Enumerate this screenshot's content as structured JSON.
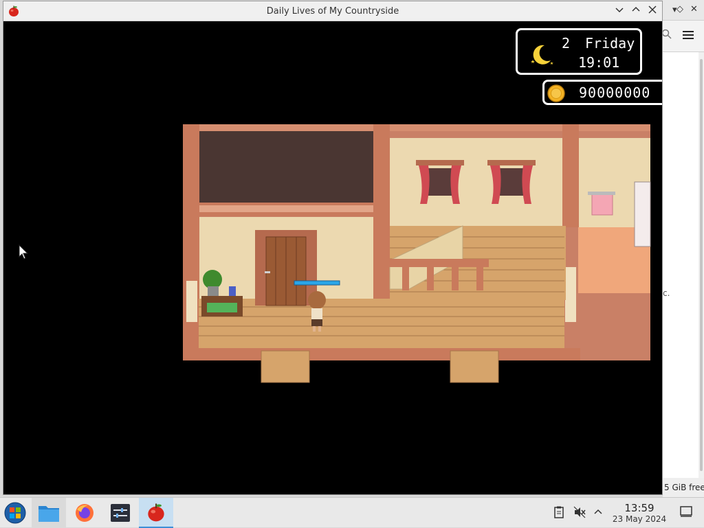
{
  "window": {
    "title": "Daily Lives of My Countryside",
    "controls": [
      "minimize",
      "maximize",
      "close"
    ]
  },
  "hud": {
    "day_number": "2",
    "weekday": "Friday",
    "time": "19:01",
    "money": "90000000",
    "time_of_day_icon": "moon-icon",
    "currency_icon": "coin-icon"
  },
  "background_app": {
    "status_text": "5 GiB free",
    "fragment_text": "c."
  },
  "taskbar": {
    "start_icon": "start-menu-icon",
    "apps": [
      {
        "name": "file-manager",
        "icon": "folder-icon"
      },
      {
        "name": "firefox",
        "icon": "firefox-icon"
      },
      {
        "name": "system-settings",
        "icon": "sliders-icon"
      },
      {
        "name": "game",
        "icon": "apple-icon",
        "active": true
      }
    ],
    "clock_time": "13:59",
    "clock_date": "23 May 2024"
  },
  "colors": {
    "wall_beige": "#ecd9b0",
    "wood_trim": "#c97a5c",
    "floor_wood": "#d2a46b",
    "hud_bg": "#000000",
    "hud_border": "#ffffff",
    "taskbar_active": "#c7dff2"
  }
}
